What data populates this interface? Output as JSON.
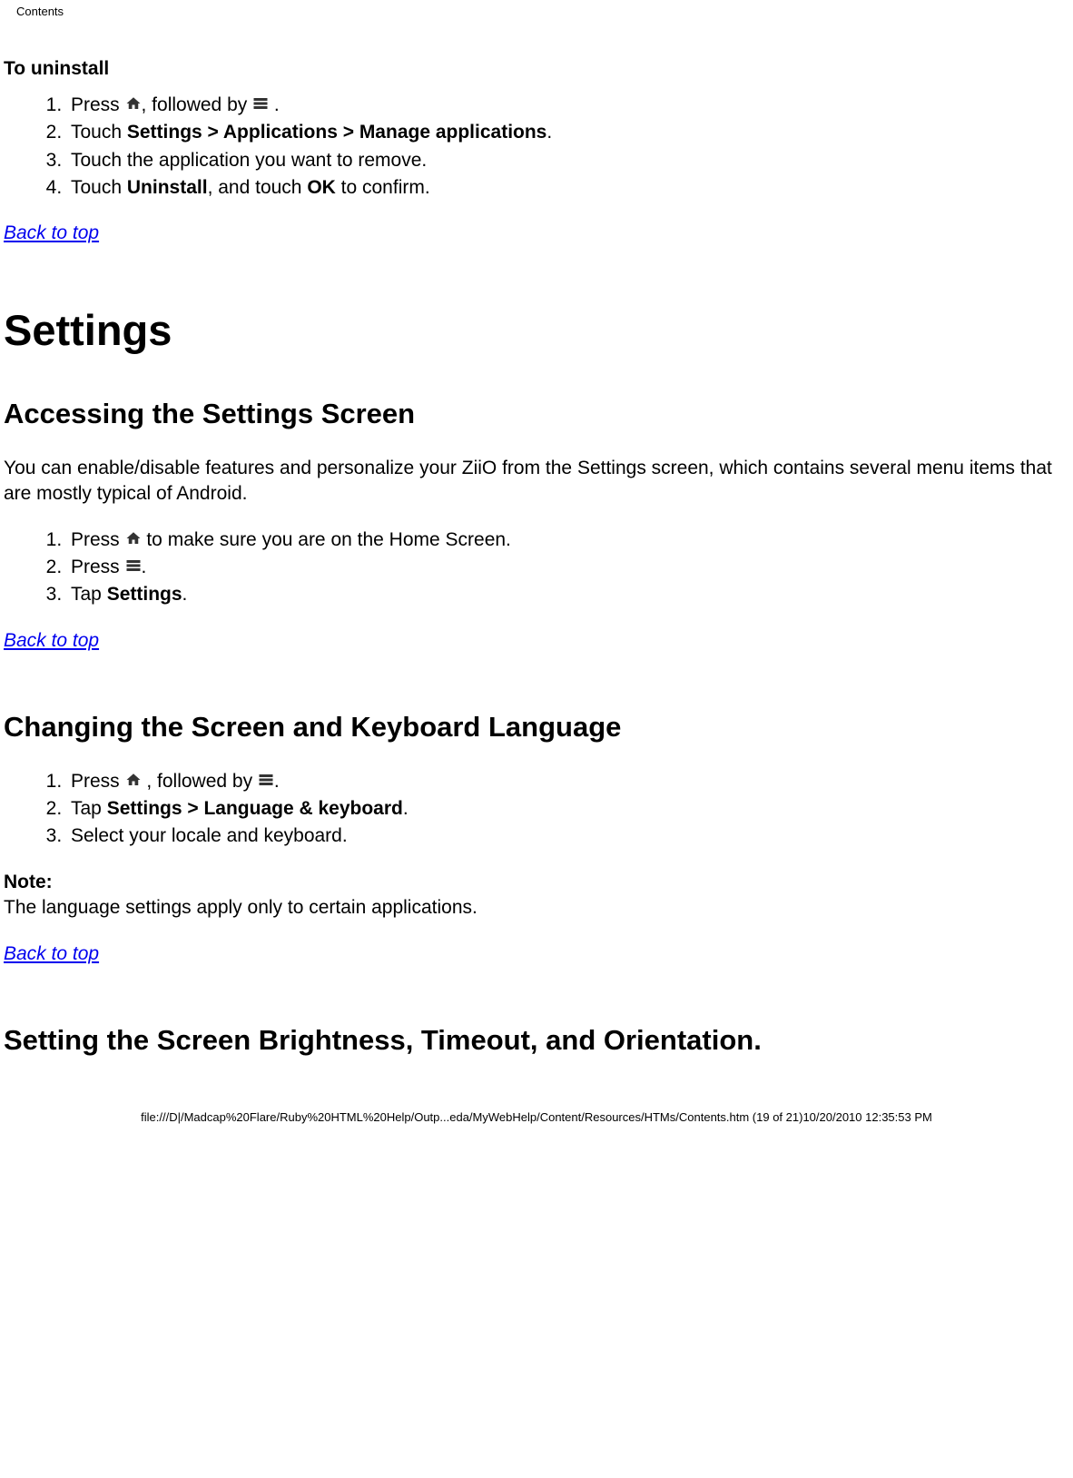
{
  "header": {
    "label": "Contents"
  },
  "uninstall": {
    "heading": "To uninstall",
    "steps": {
      "s1_a": "Press ",
      "s1_b": ", followed by ",
      "s1_c": " .",
      "s2_a": "Touch ",
      "s2_b": "Settings > Applications > Manage applications",
      "s2_c": ".",
      "s3": "Touch the application you want to remove.",
      "s4_a": "Touch ",
      "s4_b": "Uninstall",
      "s4_c": ", and touch ",
      "s4_d": "OK",
      "s4_e": " to confirm."
    },
    "back": "Back to top"
  },
  "settings": {
    "h1": "Settings",
    "accessing": {
      "h2": "Accessing the Settings Screen",
      "intro": "You can enable/disable features and personalize your ZiiO from the Settings screen, which contains several menu items that are mostly typical of Android.",
      "steps": {
        "s1_a": "Press ",
        "s1_b": " to make sure you are on the Home Screen.",
        "s2_a": "Press ",
        "s2_b": ".",
        "s3_a": "Tap ",
        "s3_b": "Settings",
        "s3_c": "."
      },
      "back": "Back to top"
    },
    "language": {
      "h2": "Changing the Screen and Keyboard Language",
      "steps": {
        "s1_a": "Press ",
        "s1_b": " , followed by ",
        "s1_c": ".",
        "s2_a": "Tap ",
        "s2_b": "Settings > Language & keyboard",
        "s2_c": ".",
        "s3": "Select your locale and keyboard."
      },
      "note_label": "Note:",
      "note_text": "The language settings apply only to certain applications.",
      "back": "Back to top"
    },
    "brightness": {
      "h2": "Setting the Screen Brightness, Timeout, and Orientation."
    }
  },
  "footer": {
    "text": "file:///D|/Madcap%20Flare/Ruby%20HTML%20Help/Outp...eda/MyWebHelp/Content/Resources/HTMs/Contents.htm (19 of 21)10/20/2010 12:35:53 PM"
  }
}
